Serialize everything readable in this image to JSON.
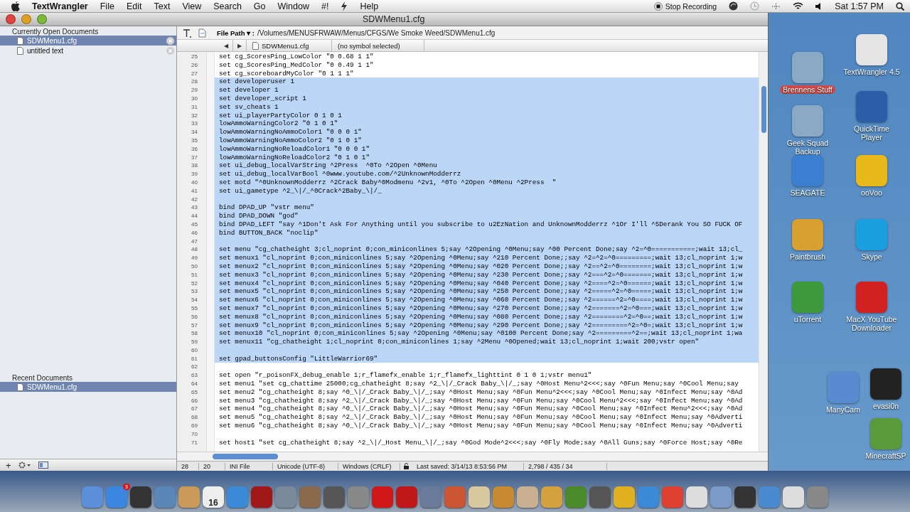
{
  "menubar": {
    "app": "TextWrangler",
    "menus": [
      "File",
      "Edit",
      "Text",
      "View",
      "Search",
      "Go",
      "Window",
      "#!"
    ],
    "help": "Help",
    "recording": "Stop Recording",
    "clock": "Sat 1:57 PM"
  },
  "window": {
    "title": "SDWMenu1.cfg"
  },
  "sidebar": {
    "open_header": "Currently Open Documents",
    "open_items": [
      {
        "label": "SDWMenu1.cfg",
        "selected": true
      },
      {
        "label": "untitled text",
        "selected": false
      }
    ],
    "recent_header": "Recent Documents",
    "recent_items": [
      {
        "label": "SDWMenu1.cfg",
        "selected": true
      }
    ],
    "add": "+"
  },
  "toolbar": {
    "path_label": "File Path ▾ :",
    "path": "/Volumes/MENUSFRWAW/Menus/CFGS/We Smoke Weed/SDWMenu1.cfg"
  },
  "navbar": {
    "back": "◀",
    "forward": "▶",
    "file": "SDWMenu1.cfg",
    "symbol": "(no symbol selected)"
  },
  "lines": [
    {
      "n": "25",
      "text": "set cg_ScoresPing_LowColor \"0 0.68 1 1\"",
      "selected": false
    },
    {
      "n": "26",
      "text": "set cg_ScoresPing_MedColor \"0 0.49 1 1\"",
      "selected": false
    },
    {
      "n": "27",
      "text": "set cg_scoreboardMyColor \"0 1 1 1\"",
      "selected": false
    },
    {
      "n": "28",
      "text": "set developeruser 1",
      "selected": true
    },
    {
      "n": "29",
      "text": "set developer 1",
      "selected": true
    },
    {
      "n": "30",
      "text": "set developer_script 1",
      "selected": true
    },
    {
      "n": "31",
      "text": "set sv_cheats 1",
      "selected": true
    },
    {
      "n": "32",
      "text": "set ui_playerPartyColor 0 1 0 1",
      "selected": true
    },
    {
      "n": "33",
      "text": "lowAmmoWarningColor2 \"0 1 0 1\"",
      "selected": true
    },
    {
      "n": "34",
      "text": "lowAmmoWarningNoAmmoColor1 \"0 0 0 1\"",
      "selected": true
    },
    {
      "n": "35",
      "text": "lowAmmoWarningNoAmmoColor2 \"0 1 0 1\"",
      "selected": true
    },
    {
      "n": "36",
      "text": "lowAmmoWarningNoReloadColor1 \"0 0 0 1\"",
      "selected": true
    },
    {
      "n": "37",
      "text": "lowAmmoWarningNoReloadColor2 \"0 1 0 1\"",
      "selected": true
    },
    {
      "n": "38",
      "text": "set ui_debug_localVarString ^2Press  ^0To ^2Open ^0Menu",
      "selected": true
    },
    {
      "n": "39",
      "text": "set ui_debug_localVarBool ^0www.youtube.com/^2UnknownModderrz",
      "selected": true
    },
    {
      "n": "40",
      "text": "set motd \"^0UnknownModderrz ^2Crack Baby^0Modmenu ^2v1, ^0To ^2Open ^0Menu ^2Press  \"",
      "selected": true
    },
    {
      "n": "41",
      "text": "set ui_gametype ^2_\\|/_^0Crack^2Baby_\\|/_",
      "selected": true
    },
    {
      "n": "42",
      "selected": true
    },
    {
      "n": "43",
      "text": "bind DPAD_UP \"vstr menu\"",
      "selected": true
    },
    {
      "n": "44",
      "text": "bind DPAD_DOWN \"god\"",
      "selected": true
    },
    {
      "n": "45",
      "text": "bind DPAD_LEFT \"say ^1Don't Ask For Anything until you subscribe to u2EzNation and UnknownModderrz ^1Or I'll ^5Derank You SO FUCK OF",
      "selected": true
    },
    {
      "n": "46",
      "text": "bind BUTTON_BACK \"noclip\"",
      "selected": true
    },
    {
      "n": "47",
      "selected": true
    },
    {
      "n": "48",
      "text": "set menu \"cg_chatheight 3;cl_noprint 0;con_miniconlines 5;say ^2Opening ^0Menu;say ^00 Percent Done;say ^2=^0===========;wait 13;cl_",
      "selected": true
    },
    {
      "n": "49",
      "text": "set menux1 \"cl_noprint 0;con_miniconlines 5;say ^2Opening ^0Menu;say ^210 Percent Done;;say ^2=^2=^0=========;wait 13;cl_noprint 1;w",
      "selected": true
    },
    {
      "n": "50",
      "text": "set menux2 \"cl_noprint 0;con_miniconlines 5;say ^2Opening ^0Menu;say ^020 Percent Done;;say ^2==^2=^0========;wait 13;cl_noprint 1;w",
      "selected": true
    },
    {
      "n": "51",
      "text": "set menux3 \"cl_noprint 0;con_miniconlines 5;say ^2Opening ^0Menu;say ^230 Percent Done;;say ^2===^2=^0=======;wait 13;cl_noprint 1;w",
      "selected": true
    },
    {
      "n": "52",
      "text": "set menux4 \"cl_noprint 0;con_miniconlines 5;say ^2Opening ^0Menu;say ^040 Percent Done;;say ^2====^2=^0======;wait 13;cl_noprint 1;w",
      "selected": true
    },
    {
      "n": "53",
      "text": "set menux5 \"cl_noprint 0;con_miniconlines 5;say ^2Opening ^0Menu;say ^250 Percent Done;;say ^2=====^2=^0=====;wait 13;cl_noprint 1;w",
      "selected": true
    },
    {
      "n": "54",
      "text": "set menux6 \"cl_noprint 0;con_miniconlines 5;say ^2Opening ^0Menu;say ^060 Percent Done;;say ^2======^2=^0====;wait 13;cl_noprint 1;w",
      "selected": true
    },
    {
      "n": "55",
      "text": "set menux7 \"cl_noprint 0;con_miniconlines 5;say ^2Opening ^0Menu;say ^270 Percent Done;;say ^2=======^2=^0===;wait 13;cl_noprint 1;w",
      "selected": true
    },
    {
      "n": "56",
      "text": "set menux8 \"cl_noprint 0;con_miniconlines 5;say ^2Opening ^0Menu;say ^080 Percent Done;;say ^2========^2=^0==;wait 13;cl_noprint 1;w",
      "selected": true
    },
    {
      "n": "57",
      "text": "set menux9 \"cl_noprint 0;con_miniconlines 5;say ^2Opening ^0Menu;say ^290 Percent Done;;say ^2=========^2=^0=;wait 13;cl_noprint 1;w",
      "selected": true
    },
    {
      "n": "58",
      "text": "set menux10 \"cl_noprint 0;con_miniconlines 5;say ^2Opening ^0Menu;say ^0100 Percent Done;say ^2=========^2==;wait 13;cl_noprint 1;wa",
      "selected": true
    },
    {
      "n": "59",
      "text": "set menux11 \"cg_chatheight 1;cl_noprint 0;con_miniconlines 1;say ^2Menu ^0Opened;wait 13;cl_noprint 1;wait 200;vstr open\"",
      "selected": true
    },
    {
      "n": "60",
      "selected": true
    },
    {
      "n": "61",
      "text": "set gpad_buttonsConfig \"LittleWarrior69\"",
      "selected": true
    },
    {
      "n": "62",
      "selected": false
    },
    {
      "n": "63",
      "text": "set open \"r_poisonFX_debug_enable 1;r_flamefx_enable 1;r_flamefx_lighttint 0 1 0 1;vstr menu1\"",
      "selected": false
    },
    {
      "n": "64",
      "text": "set menu1 \"set cg_chattime 25000;cg_chatheight 8;say ^2_\\|/_Crack Baby_\\|/_;say ^0Host Menu^2<<<;say ^0Fun Menu;say ^0Cool Menu;say",
      "selected": false
    },
    {
      "n": "65",
      "text": "set menu2 \"cg_chatheight 8;say ^0_\\|/_Crack Baby_\\|/_;say ^0Host Menu;say ^0Fun Menu^2<<<;say ^0Cool Menu;say ^0Infect Menu;say ^0Ad",
      "selected": false
    },
    {
      "n": "66",
      "text": "set menu3 \"cg_chatheight 8;say ^2_\\|/_Crack Baby_\\|/_;say ^0Host Menu;say ^0Fun Menu;say ^0Cool Menu^2<<<;say ^0Infect Menu;say ^0Ad",
      "selected": false
    },
    {
      "n": "67",
      "text": "set menu4 \"cg_chatheight 8;say ^0_\\|/_Crack Baby_\\|/_;say ^0Host Menu;say ^0Fun Menu;say ^0Cool Menu;say ^0Infect Menu^2<<<;say ^0Ad",
      "selected": false
    },
    {
      "n": "68",
      "text": "set menu5 \"cg_chatheight 8;say ^2_\\|/_Crack Baby_\\|/_;say ^0Host Menu;say ^0Fun Menu;say ^0Cool Menu;say ^0Infect Menu;say ^0Adverti",
      "selected": false
    },
    {
      "n": "69",
      "text": "set menu6 \"cg_chatheight 8;say ^0_\\|/_Crack Baby_\\|/_;say ^0Host Menu;say ^0Fun Menu;say ^0Cool Menu;say ^0Infect Menu;say ^0Adverti",
      "selected": false
    },
    {
      "n": "70",
      "selected": false
    },
    {
      "n": "71",
      "text": "set host1 \"set cg_chatheight 8;say ^2_\\|/_Host Menu_\\|/_;say ^0God Mode^2<<<;say ^0Fly Mode;say ^0All Guns;say ^0Force Host;say ^0Re",
      "selected": false
    }
  ],
  "status_bar": {
    "line": "28",
    "column": "20",
    "language": "INI File",
    "encoding": "Unicode (UTF-8)",
    "line_endings": "Windows (CRLF)",
    "saved": "Last saved: 3/14/13 8:53:56 PM",
    "counts": "2,798 / 435 / 34"
  },
  "desktop": [
    {
      "label": "Brennens Stuff",
      "selected": true,
      "color": "#8aa9c4"
    },
    {
      "label": "TextWrangler 4.5",
      "selected": false,
      "color": "#e4e4e4"
    },
    {
      "label": "Geek Squad Backup",
      "selected": false,
      "color": "#8aa9c4"
    },
    {
      "label": "QuickTime Player",
      "selected": false,
      "color": "#2a5fa8"
    },
    {
      "label": "SEAGATE",
      "selected": false,
      "color": "#3a7fd0"
    },
    {
      "label": "ooVoo",
      "selected": false,
      "color": "#e8b818"
    },
    {
      "label": "Paintbrush",
      "selected": false,
      "color": "#d8a030"
    },
    {
      "label": "Skype",
      "selected": false,
      "color": "#1aa0e0"
    },
    {
      "label": "uTorrent",
      "selected": false,
      "color": "#3c9a3c"
    },
    {
      "label": "MacX YouTube Downloader",
      "selected": false,
      "color": "#d02020"
    },
    {
      "label": "ManyCam",
      "selected": false,
      "color": "#5a8ad0"
    },
    {
      "label": "evasi0n",
      "selected": false,
      "color": "#222222"
    },
    {
      "label": "MinecraftSP",
      "selected": false,
      "color": "#5a9a3a"
    }
  ],
  "dock": {
    "badge": "3",
    "calendar_day": "16"
  }
}
